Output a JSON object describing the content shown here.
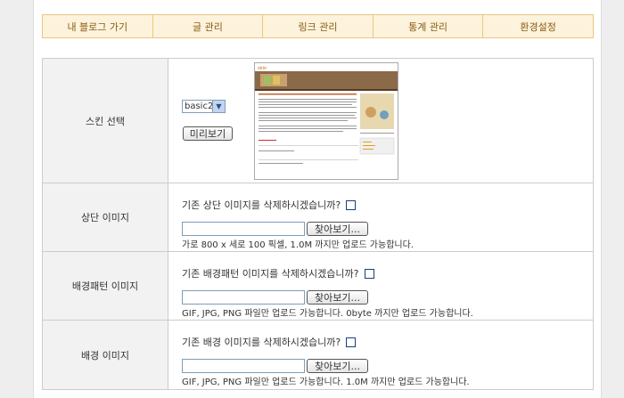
{
  "nav": {
    "tabs": [
      "내 블로그 가기",
      "글 관리",
      "링크 관리",
      "통계 관리",
      "환경설정"
    ]
  },
  "skin": {
    "label": "스킨 선택",
    "selected": "basic2",
    "preview_button": "미리보기",
    "thumbnail_header": "skin"
  },
  "top_image": {
    "label": "상단 이미지",
    "delete_question": "기존 상단 이미지를 삭제하시겠습니까?",
    "browse_button": "찾아보기...",
    "hint": "가로 800 x 세로 100 픽셀, 1.0M 까지만 업로드 가능합니다."
  },
  "bg_pattern": {
    "label": "배경패턴 이미지",
    "delete_question": "기존 배경패턴 이미지를 삭제하시겠습니까?",
    "browse_button": "찾아보기...",
    "hint": "GIF, JPG, PNG 파일만 업로드 가능합니다. 0byte 까지만 업로드 가능합니다."
  },
  "bg_image": {
    "label": "배경 이미지",
    "delete_question": "기존 배경 이미지를 삭제하시겠습니까?",
    "browse_button": "찾아보기...",
    "hint": "GIF, JPG, PNG 파일만 업로드 가능합니다. 1.0M 까지만 업로드 가능합니다."
  }
}
